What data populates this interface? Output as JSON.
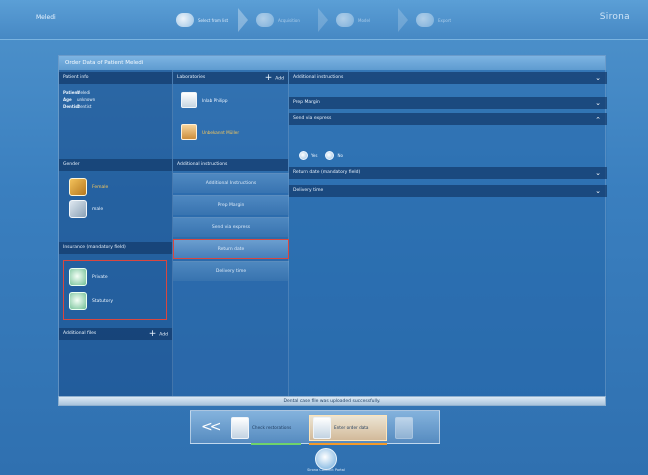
{
  "header": {
    "patient_name": "Meledi",
    "brand": "Sirona",
    "steps": [
      {
        "label": "Select from list",
        "icon": "tooth-scan-icon"
      },
      {
        "label": "Acquisition",
        "icon": "scan-icon"
      },
      {
        "label": "Model",
        "icon": "model-icon"
      },
      {
        "label": "Export",
        "icon": "export-icon"
      }
    ]
  },
  "panel": {
    "title": "Order Data of Patient Meledi",
    "patient_info": {
      "title": "Patient info",
      "rows": [
        {
          "key": "Patient",
          "value": "Meledi"
        },
        {
          "key": "Age",
          "value": "unknown"
        },
        {
          "key": "Dentist",
          "value": "Dentist"
        }
      ]
    },
    "gender": {
      "title": "Gender",
      "options": [
        {
          "label": "Female",
          "icon": "female-icon"
        },
        {
          "label": "male",
          "icon": "male-icon"
        }
      ]
    },
    "insurance": {
      "title": "Insurance   (mandatory field)",
      "options": [
        {
          "label": "Private",
          "icon": "private-insurance-icon"
        },
        {
          "label": "Statutory",
          "icon": "statutory-insurance-icon"
        }
      ]
    },
    "additional_files": {
      "title": "Additional files",
      "add_label": "Add"
    },
    "laboratories": {
      "title": "Laboratories",
      "add_label": "Add",
      "items": [
        {
          "label": "Inlab Philipp",
          "highlight": false
        },
        {
          "label": "Unbekannt Müller",
          "highlight": true
        }
      ]
    },
    "additional_instructions_menu": {
      "title": "Additional instructions",
      "items": [
        "Additional Instructions",
        "Prep Margin",
        "Send via express",
        "Return date",
        "Delivery time"
      ],
      "selected_index": 3
    },
    "details": {
      "sections": [
        {
          "label": "Additional instructions",
          "chevron": "down"
        },
        {
          "label": "Prep Margin",
          "chevron": "down"
        },
        {
          "label": "Send via express",
          "chevron": "up"
        },
        {
          "label": "Return date   (mandatory field)",
          "chevron": "down"
        },
        {
          "label": "Delivery time",
          "chevron": "down"
        }
      ],
      "express_options": [
        "Yes",
        "No"
      ]
    }
  },
  "status_message": "Dental case file was uploaded successfully.",
  "navigation": {
    "back_label": "<<",
    "steps": [
      {
        "label": "Check restorations"
      },
      {
        "label": "Enter order data"
      }
    ]
  },
  "footer": {
    "label": "Sirona Connect Portal"
  }
}
